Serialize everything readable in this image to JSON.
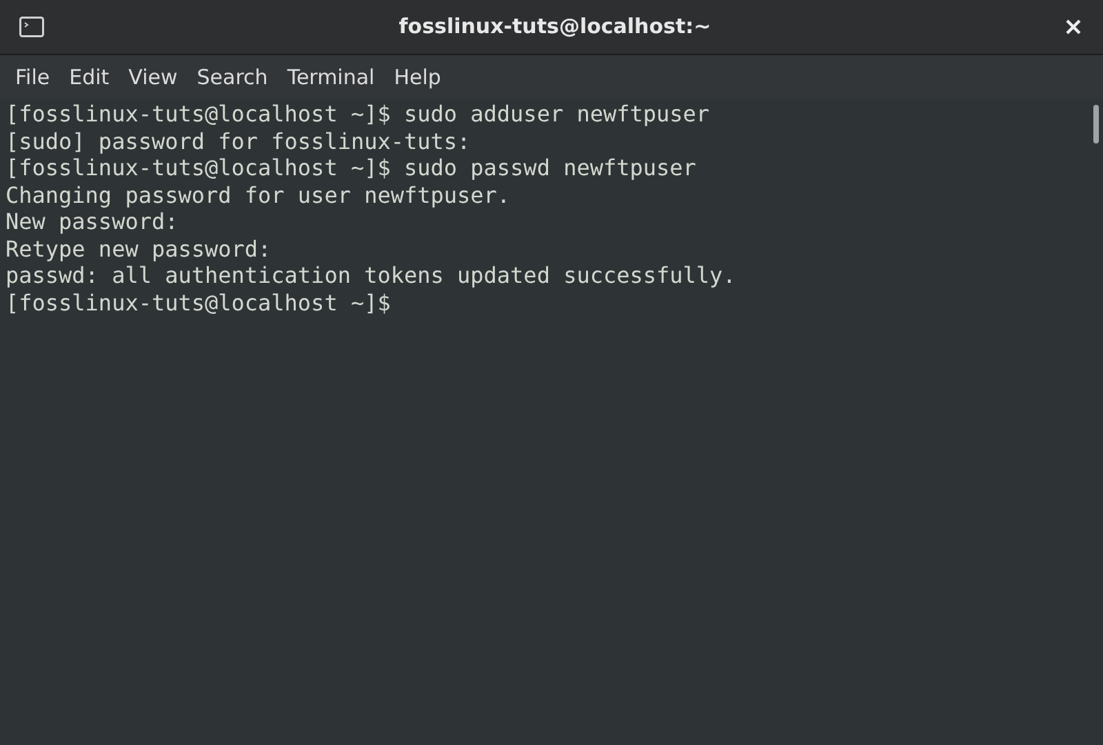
{
  "window": {
    "title": "fosslinux-tuts@localhost:~"
  },
  "menu": [
    "File",
    "Edit",
    "View",
    "Search",
    "Terminal",
    "Help"
  ],
  "terminal": {
    "lines": [
      "[fosslinux-tuts@localhost ~]$ sudo adduser newftpuser",
      "[sudo] password for fosslinux-tuts:",
      "[fosslinux-tuts@localhost ~]$ sudo passwd newftpuser",
      "Changing password for user newftpuser.",
      "New password:",
      "Retype new password:",
      "passwd: all authentication tokens updated successfully.",
      "[fosslinux-tuts@localhost ~]$"
    ]
  }
}
